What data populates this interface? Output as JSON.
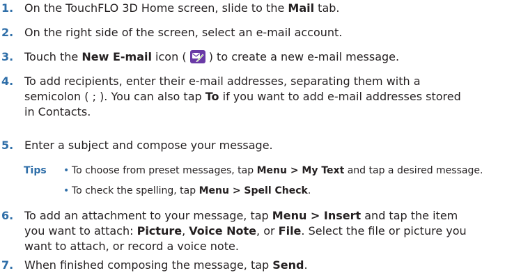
{
  "steps": [
    {
      "num": "1.",
      "a": "On the TouchFLO 3D Home screen, slide to the ",
      "b": "Mail",
      "c": " tab."
    },
    {
      "num": "2.",
      "text": "On the right side of the screen, select an e-mail account."
    },
    {
      "num": "3.",
      "a": "Touch the ",
      "b": "New E-mail",
      "c": " icon ( ",
      "d": " ) to create a new e-mail message."
    },
    {
      "num": "4.",
      "l1": "To add recipients, enter their e-mail addresses, separating them with a",
      "l2a": "semicolon ( ; ). You can also tap ",
      "l2b": "To",
      "l2c": " if you want to add e-mail addresses stored",
      "l3": "in Contacts."
    },
    {
      "num": "5.",
      "text": "Enter a subject and compose your message."
    },
    {
      "num": "6.",
      "l1a": "To add an attachment to your message, tap ",
      "l1b": "Menu > Insert",
      "l1c": " and tap the item",
      "l2a": "you want to attach: ",
      "l2b": "Picture",
      "l2c": ", ",
      "l2d": "Voice Note",
      "l2e": ", or ",
      "l2f": "File",
      "l2g": ". Select the file or picture you",
      "l3": "want to attach, or record a voice note."
    },
    {
      "num": "7.",
      "a": "When finished composing the message, tap ",
      "b": "Send",
      "c": "."
    }
  ],
  "tips": {
    "label": "Tips",
    "bullet": "•",
    "items": [
      {
        "a": "To choose from preset messages, tap ",
        "b": "Menu > My Text",
        "c": " and tap a desired message."
      },
      {
        "a": "To check the spelling, tap ",
        "b": "Menu > Spell Check",
        "c": "."
      }
    ]
  },
  "icon": "new-email-icon",
  "colors": {
    "accent": "#2e6ea8",
    "text": "#231f20",
    "icon_bg": "#6a3aa6"
  }
}
